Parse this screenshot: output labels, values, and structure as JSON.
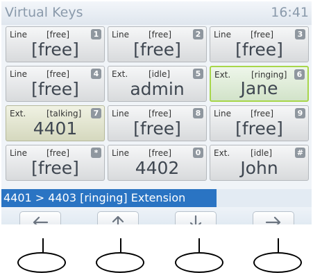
{
  "header": {
    "title": "Virtual Keys",
    "time": "16:41"
  },
  "keys": [
    {
      "type": "Line",
      "status": "[free]",
      "badge": "1",
      "name": "[free]",
      "state": "idle"
    },
    {
      "type": "Line",
      "status": "[free]",
      "badge": "2",
      "name": "[free]",
      "state": "idle"
    },
    {
      "type": "Line",
      "status": "[free]",
      "badge": "3",
      "name": "[free]",
      "state": "idle"
    },
    {
      "type": "Line",
      "status": "[free]",
      "badge": "4",
      "name": "[free]",
      "state": "idle"
    },
    {
      "type": "Ext.",
      "status": "[idle]",
      "badge": "5",
      "name": "admin",
      "state": "idle"
    },
    {
      "type": "Ext.",
      "status": "[ringing]",
      "badge": "6",
      "name": "Jane",
      "state": "ringing"
    },
    {
      "type": "Ext.",
      "status": "[talking]",
      "badge": "7",
      "name": "4401",
      "state": "talking"
    },
    {
      "type": "Line",
      "status": "[free]",
      "badge": "8",
      "name": "[free]",
      "state": "idle"
    },
    {
      "type": "Line",
      "status": "[free]",
      "badge": "9",
      "name": "[free]",
      "state": "idle"
    },
    {
      "type": "Line",
      "status": "[free]",
      "badge": "*",
      "name": "[free]",
      "state": "idle"
    },
    {
      "type": "Line",
      "status": "[free]",
      "badge": "0",
      "name": "4402",
      "state": "idle"
    },
    {
      "type": "Ext.",
      "status": "[idle]",
      "badge": "#",
      "name": "John",
      "state": "idle"
    }
  ],
  "status_bar": {
    "text": "4401 > 4403 [ringing] Extension"
  },
  "softkeys": [
    {
      "icon": "arrow-left-icon"
    },
    {
      "icon": "arrow-up-icon"
    },
    {
      "icon": "arrow-down-icon"
    },
    {
      "icon": "arrow-right-icon"
    }
  ],
  "colors": {
    "status_bar": "#2a74c3",
    "ringing_border": "#a7d64a",
    "badge": "#8f979f"
  }
}
